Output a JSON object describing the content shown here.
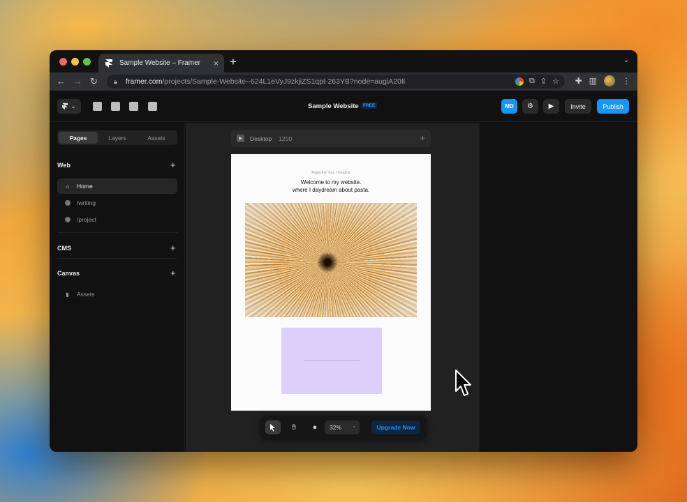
{
  "browser": {
    "tab_title": "Sample Website – Framer",
    "new_tab_symbol": "+",
    "tab_close_symbol": "×",
    "tab_menu_symbol": "⌄",
    "url_host": "framer.com",
    "url_path": "/projects/Sample-Website--624L1eVyJ9zkjiZS1qpt-263YB?node=augiA20Il"
  },
  "app": {
    "project_title": "Sample Website",
    "plan_badge": "FREE",
    "avatar_initials": "MD",
    "invite_label": "Invite",
    "publish_label": "Publish"
  },
  "left_panel": {
    "tabs": [
      {
        "label": "Pages"
      },
      {
        "label": "Layers"
      },
      {
        "label": "Assets"
      }
    ],
    "sections": {
      "web": {
        "title": "Web",
        "pages": [
          {
            "label": "Home"
          },
          {
            "label": "/writing"
          },
          {
            "label": "/project"
          }
        ]
      },
      "cms": {
        "title": "CMS"
      },
      "canvas": {
        "title": "Canvas",
        "items": [
          {
            "label": "Assets"
          }
        ]
      }
    },
    "add_symbol": "+"
  },
  "canvas": {
    "frame_label": "Desktop",
    "frame_width": "1200",
    "add_symbol": "+",
    "site": {
      "kicker": "Pasta For Your Thoughts",
      "heading_line1": "Welcome to my website.",
      "heading_line2": "where I daydream about pasta."
    },
    "bottom_toolbar": {
      "zoom": "32%",
      "upgrade_label": "Upgrade Now"
    }
  },
  "colors": {
    "accent": "#1995f5",
    "lilac": "#dcd0fb",
    "panel_bg": "#111111",
    "canvas_bg": "#212121"
  }
}
